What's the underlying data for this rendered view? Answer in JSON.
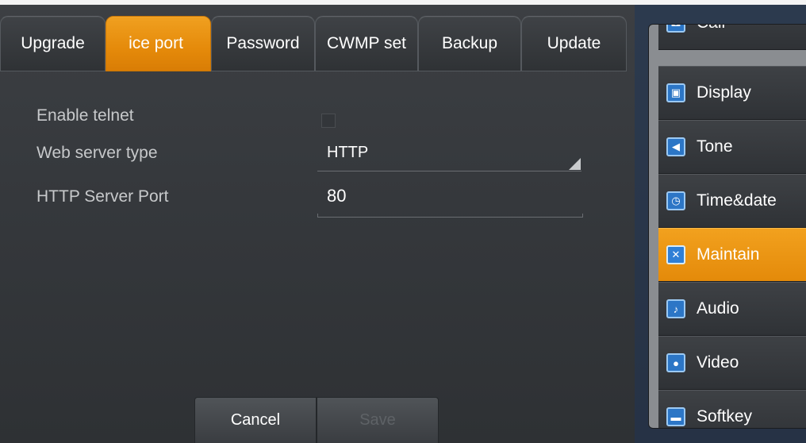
{
  "tabs": [
    {
      "label": "Upgrade",
      "active": false
    },
    {
      "label": "ice port",
      "active": true
    },
    {
      "label": "Password",
      "active": false
    },
    {
      "label": "CWMP set",
      "active": false
    },
    {
      "label": "Backup",
      "active": false
    },
    {
      "label": "Update",
      "active": false
    }
  ],
  "form": {
    "enable_telnet_label": "Enable telnet",
    "enable_telnet_checked": false,
    "web_server_type_label": "Web server type",
    "web_server_type_value": "HTTP",
    "http_port_label": "HTTP Server Port",
    "http_port_value": "80"
  },
  "actions": {
    "cancel_label": "Cancel",
    "save_label": "Save"
  },
  "sidebar": {
    "items": [
      {
        "label": "Call",
        "icon": "phone-icon",
        "active": false
      },
      {
        "label": "Display",
        "icon": "monitor-icon",
        "active": false
      },
      {
        "label": "Tone",
        "icon": "speaker-icon",
        "active": false
      },
      {
        "label": "Time&date",
        "icon": "clock-icon",
        "active": false
      },
      {
        "label": "Maintain",
        "icon": "tools-icon",
        "active": true
      },
      {
        "label": "Audio",
        "icon": "microphone-icon",
        "active": false
      },
      {
        "label": "Video",
        "icon": "camera-icon",
        "active": false
      },
      {
        "label": "Softkey",
        "icon": "keyboard-icon",
        "active": false
      }
    ]
  },
  "colors": {
    "accent": "#e8900f",
    "panel": "#36393d",
    "icon_blue": "#2c76c6"
  }
}
